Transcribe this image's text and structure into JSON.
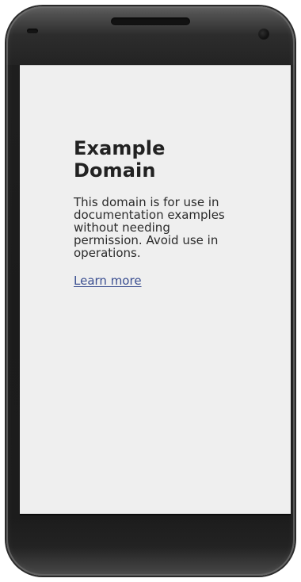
{
  "page": {
    "heading": "Example Domain",
    "body_text": "This domain is for use in documentation examples without needing permission. Avoid use in operations.",
    "link_text": "Learn more"
  },
  "colors": {
    "screen_background": "#efefef",
    "text": "#2b2b2b",
    "link": "#3b4f91",
    "device_frame": "#1b1b1b"
  }
}
